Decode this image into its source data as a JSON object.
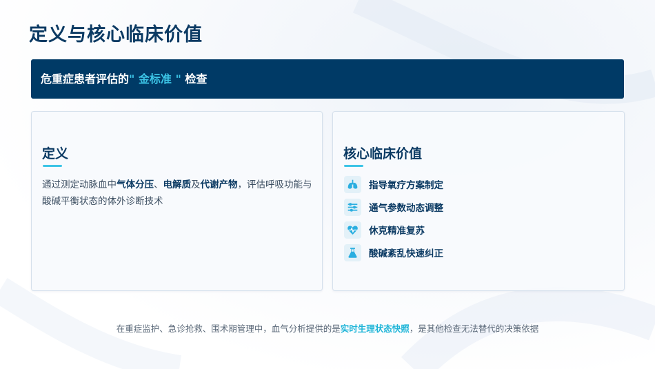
{
  "title": "定义与核心临床价值",
  "banner": {
    "prefix": "危重症患者评估的",
    "highlight": "\" 金标准 \"",
    "suffix": "检查"
  },
  "definition": {
    "heading": "定义",
    "parts": [
      {
        "text": "通过测定动脉血中",
        "bold": false
      },
      {
        "text": "气体分压",
        "bold": true
      },
      {
        "text": "、",
        "bold": false
      },
      {
        "text": "电解质",
        "bold": true
      },
      {
        "text": "及",
        "bold": false
      },
      {
        "text": "代谢产物",
        "bold": true
      },
      {
        "text": "，评估呼吸功能与酸碱平衡状态的体外诊断技术",
        "bold": false
      }
    ]
  },
  "values": {
    "heading": "核心临床价值",
    "items": [
      {
        "label": "指导氧疗方案制定",
        "icon": "lungs-icon"
      },
      {
        "label": "通气参数动态调整",
        "icon": "sliders-icon"
      },
      {
        "label": "休克精准复苏",
        "icon": "heartbeat-icon"
      },
      {
        "label": "酸碱紊乱快速纠正",
        "icon": "flask-icon"
      }
    ]
  },
  "footer": {
    "prefix": "在重症监护、急诊抢救、围术期管理中，血气分析提供的是",
    "highlight": "实时生理状态快照",
    "suffix": "，是其他检查无法替代的决策依据"
  },
  "colors": {
    "primary": "#0b3a63",
    "banner_bg": "#003a66",
    "accent": "#3cc4e6"
  }
}
